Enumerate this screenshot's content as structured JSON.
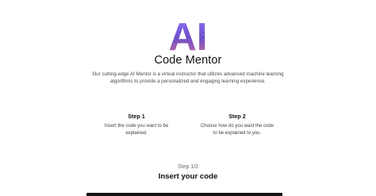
{
  "hero": {
    "logo_text": "AI",
    "title": "Code Mentor",
    "description": "Our cutting-edge AI Mentor is a virtual instructor that utilizes advanced machine learning algorithms to provide a personalized and engaging learning experience."
  },
  "steps": [
    {
      "title": "Step 1",
      "description": "Insert the code you want to be explained."
    },
    {
      "title": "Step 2",
      "description": "Choose how do you want the code to be explained to you."
    }
  ],
  "progress": {
    "label": "Step 1/2",
    "current": 1,
    "total": 2
  },
  "section": {
    "title": "Insert your code"
  },
  "colors": {
    "logo_gradient_start": "#9a6cff",
    "logo_gradient_mid": "#6c49c9",
    "logo_gradient_end": "#d46b94",
    "editor_background": "#141414"
  }
}
